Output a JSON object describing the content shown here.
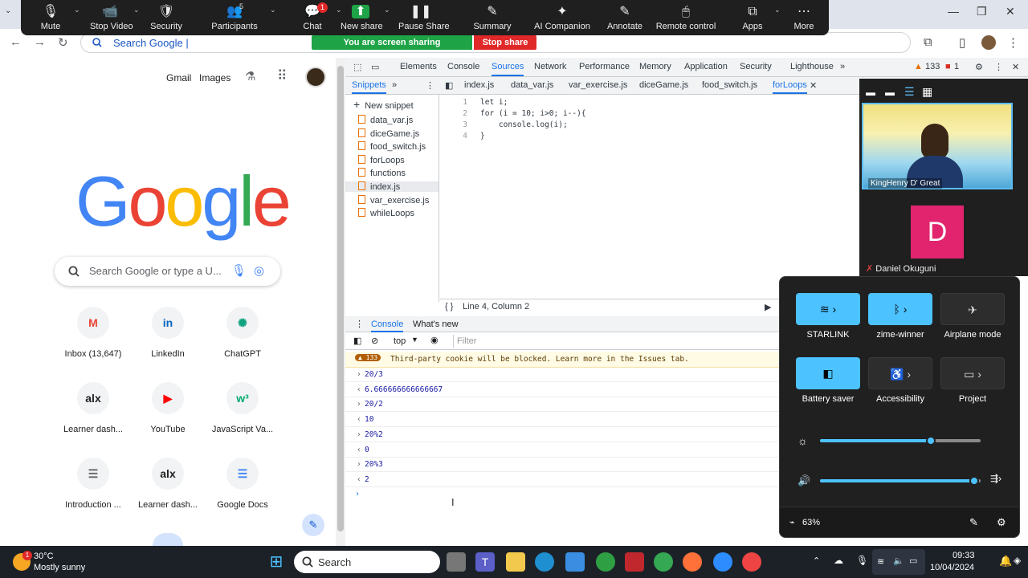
{
  "zoom_toolbar": {
    "items": [
      {
        "label": "Mute",
        "icon": "microphone-icon"
      },
      {
        "label": "Stop Video",
        "icon": "video-camera-icon"
      },
      {
        "label": "Security",
        "icon": "shield-icon"
      },
      {
        "label": "Participants",
        "icon": "participants-icon",
        "badge": "5"
      },
      {
        "label": "Chat",
        "icon": "chat-icon",
        "badge": "1"
      },
      {
        "label": "New share",
        "icon": "share-arrow-icon"
      },
      {
        "label": "Pause Share",
        "icon": "pause-icon"
      },
      {
        "label": "Summary",
        "icon": "summary-icon"
      },
      {
        "label": "AI Companion",
        "icon": "sparkle-icon"
      },
      {
        "label": "Annotate",
        "icon": "pen-icon"
      },
      {
        "label": "Remote control",
        "icon": "mouse-icon"
      },
      {
        "label": "Apps",
        "icon": "apps-icon"
      },
      {
        "label": "More",
        "icon": "more-icon"
      }
    ],
    "sharing_banner": "You are screen sharing",
    "stop_share": "Stop share"
  },
  "browser": {
    "omnibox_text": "Search Google |"
  },
  "google": {
    "links": [
      "Gmail",
      "Images"
    ],
    "logo": "Google",
    "search_placeholder": "Search Google or type a U...",
    "shortcuts": [
      {
        "label": "Inbox (13,647)",
        "icon": "gmail-icon",
        "glyph": "M",
        "color": "#ea4335"
      },
      {
        "label": "LinkedIn",
        "icon": "linkedin-icon",
        "glyph": "in",
        "color": "#0a66c2"
      },
      {
        "label": "ChatGPT",
        "icon": "chatgpt-icon",
        "glyph": "✺",
        "color": "#10a37f"
      },
      {
        "label": "Learner dash...",
        "icon": "alx-icon",
        "glyph": "alx",
        "color": "#222"
      },
      {
        "label": "YouTube",
        "icon": "youtube-icon",
        "glyph": "▶",
        "color": "#ff0000"
      },
      {
        "label": "JavaScript Va...",
        "icon": "w3schools-icon",
        "glyph": "w³",
        "color": "#04aa6d"
      },
      {
        "label": "Introduction ...",
        "icon": "page-icon",
        "glyph": "☰",
        "color": "#666"
      },
      {
        "label": "Learner dash...",
        "icon": "alx-icon",
        "glyph": "alx",
        "color": "#222"
      },
      {
        "label": "Google Docs",
        "icon": "google-docs-icon",
        "glyph": "☰",
        "color": "#4285f4"
      }
    ]
  },
  "devtools": {
    "tabs": [
      "Elements",
      "Console",
      "Sources",
      "Network",
      "Performance",
      "Memory",
      "Application",
      "Security",
      "Lighthouse"
    ],
    "active_tab": "Sources",
    "issue_count": "133",
    "error_count": "1",
    "nav_tab": "Snippets",
    "source_tabs": [
      "index.js",
      "data_var.js",
      "var_exercise.js",
      "diceGame.js",
      "food_switch.js",
      "forLoops"
    ],
    "new_snippet": "New snippet",
    "files": [
      "data_var.js",
      "diceGame.js",
      "food_switch.js",
      "forLoops",
      "functions",
      "index.js",
      "var_exercise.js",
      "whileLoops"
    ],
    "code_lines": [
      {
        "n": "1",
        "text": "let i;"
      },
      {
        "n": "2",
        "text": "for (i = 10; i>0; i--){"
      },
      {
        "n": "3",
        "text": "    console.log(i);"
      },
      {
        "n": "4",
        "text": "}"
      }
    ],
    "status": "Line 4, Column 2",
    "console_tabs": [
      "Console",
      "What's new"
    ],
    "context": "top",
    "filter_placeholder": "Filter",
    "warning_count": "133",
    "warning_text": "Third-party cookie will be blocked. Learn more in the Issues tab.",
    "console_rows": [
      {
        "dir": ">",
        "text": "20/3"
      },
      {
        "dir": "<",
        "text": "6.666666666666667"
      },
      {
        "dir": ">",
        "text": "20/2"
      },
      {
        "dir": "<",
        "text": "10"
      },
      {
        "dir": ">",
        "text": "20%2"
      },
      {
        "dir": "<",
        "text": "0"
      },
      {
        "dir": ">",
        "text": "20%3"
      },
      {
        "dir": "<",
        "text": "2"
      }
    ]
  },
  "video_panel": {
    "self_name": "KingHenry D' Great",
    "other_initial": "D",
    "other_name": "Daniel Okuguni"
  },
  "quick_settings": {
    "tiles": [
      {
        "label": "STARLINK",
        "icon": "wifi-icon",
        "on": true
      },
      {
        "label": "zime-winner",
        "icon": "bluetooth-icon",
        "on": true
      },
      {
        "label": "Airplane mode",
        "icon": "airplane-icon",
        "on": false
      },
      {
        "label": "Battery saver",
        "icon": "battery-saver-icon",
        "on": true
      },
      {
        "label": "Accessibility",
        "icon": "accessibility-icon",
        "on": false
      },
      {
        "label": "Project",
        "icon": "project-icon",
        "on": false
      }
    ],
    "brightness": 0.69,
    "volume": 0.96,
    "battery": "63%"
  },
  "taskbar": {
    "weather_temp": "30°C",
    "weather_desc": "Mostly sunny",
    "search_label": "Search",
    "time": "09:33",
    "date": "10/04/2024"
  }
}
